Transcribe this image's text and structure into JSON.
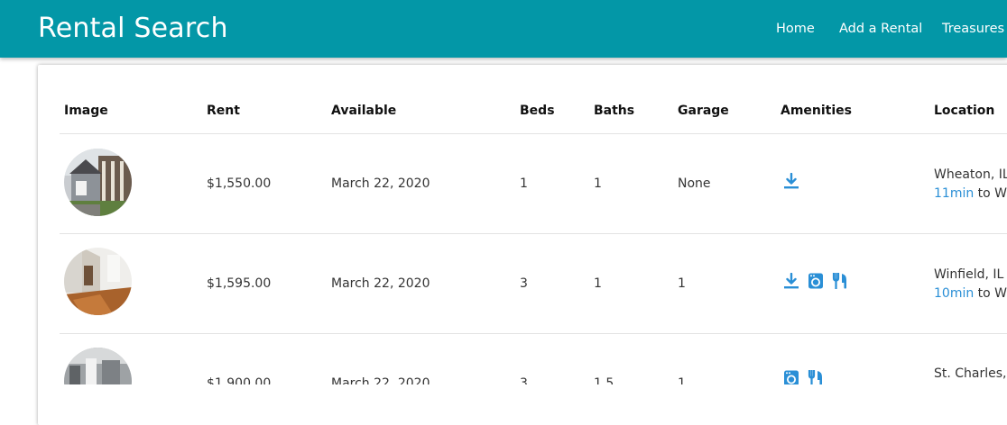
{
  "header": {
    "title": "Rental Search",
    "nav": [
      "Home",
      "Add a Rental",
      "Treasures t"
    ]
  },
  "table": {
    "columns": [
      "Image",
      "Rent",
      "Available",
      "Beds",
      "Baths",
      "Garage",
      "Amenities",
      "Location"
    ],
    "rows": [
      {
        "rent": "$1,550.00",
        "available": "March 22, 2020",
        "beds": "1",
        "baths": "1",
        "garage": "None",
        "amenities": [
          "download-icon"
        ],
        "city": "Wheaton, IL",
        "commute_minutes": "11min",
        "commute_text": " to Wo"
      },
      {
        "rent": "$1,595.00",
        "available": "March 22, 2020",
        "beds": "3",
        "baths": "1",
        "garage": "1",
        "amenities": [
          "download-icon",
          "washer-icon",
          "utensils-icon"
        ],
        "city": "Winfield, IL",
        "commute_minutes": "10min",
        "commute_text": " to Wo"
      },
      {
        "rent": "$1,900.00",
        "available": "March 22, 2020",
        "beds": "3",
        "baths": "1.5",
        "garage": "1",
        "amenities": [
          "washer-icon",
          "utensils-icon"
        ],
        "city": "St. Charles, I",
        "commute_minutes": "",
        "commute_text": ""
      }
    ]
  },
  "colors": {
    "header_bg": "#0397a7",
    "accent_blue": "#2a8fd6"
  }
}
